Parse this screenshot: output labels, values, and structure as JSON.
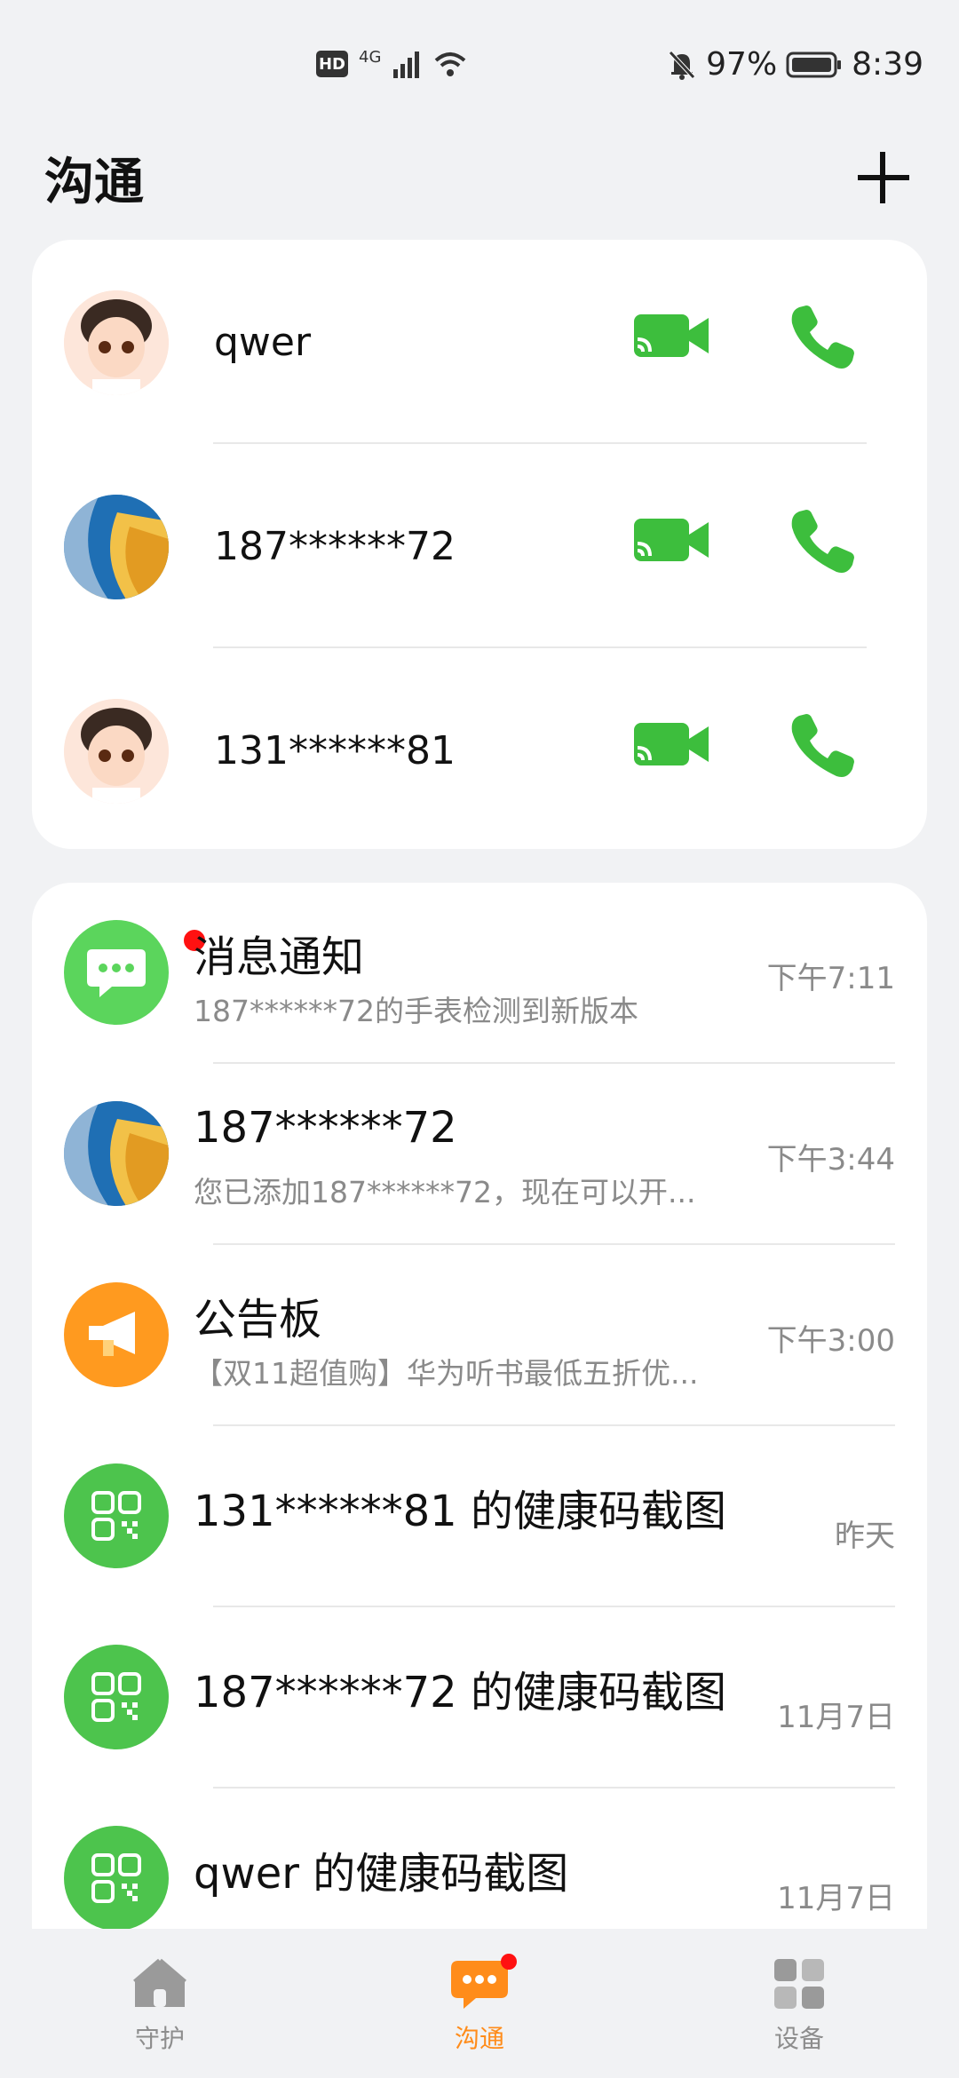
{
  "status_bar": {
    "network": "4G",
    "hd": "HD",
    "battery": "97%",
    "time": "8:39"
  },
  "header": {
    "title": "沟通"
  },
  "contacts": [
    {
      "name": "qwer",
      "avatar": "cartoon-boy"
    },
    {
      "name": "187******72",
      "avatar": "wave-wallpaper"
    },
    {
      "name": "131******81",
      "avatar": "cartoon-boy"
    }
  ],
  "messages": [
    {
      "title": "消息通知",
      "preview": "187******72的手表检测到新版本",
      "time": "下午7:11",
      "icon": "chat-bubble-icon"
    },
    {
      "title": "187******72",
      "preview": "您已添加187******72，现在可以开...",
      "time": "下午3:44",
      "icon": "wave-avatar"
    },
    {
      "title": "公告板",
      "preview": "【双11超值购】华为听书最低五折优...",
      "time": "下午3:00",
      "icon": "megaphone-icon"
    },
    {
      "title": "131******81 的健康码截图",
      "preview": "",
      "time": "昨天",
      "icon": "qr-code-icon"
    },
    {
      "title": "187******72 的健康码截图",
      "preview": "",
      "time": "11月7日",
      "icon": "qr-code-icon"
    },
    {
      "title": "qwer 的健康码截图",
      "preview": "",
      "time": "11月7日",
      "icon": "qr-code-icon"
    }
  ],
  "bottom_nav": {
    "items": [
      {
        "label": "守护",
        "icon": "home-icon"
      },
      {
        "label": "沟通",
        "icon": "chat-icon"
      },
      {
        "label": "设备",
        "icon": "devices-icon"
      }
    ]
  },
  "colors": {
    "accent": "#ff8c1a",
    "call_green": "#3dbe3d"
  }
}
